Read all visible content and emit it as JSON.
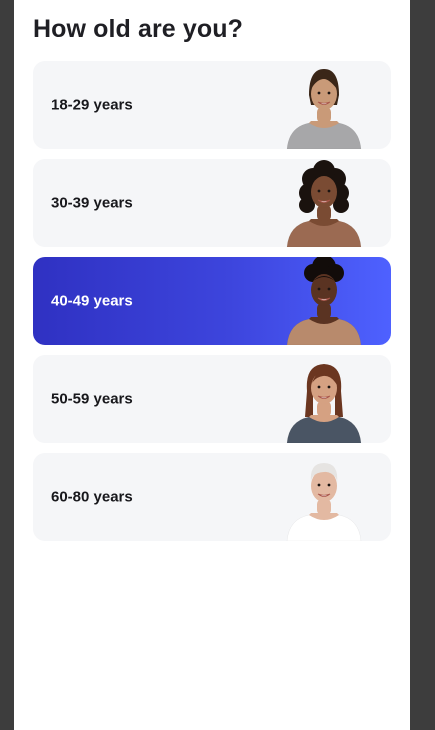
{
  "question": "How old are you?",
  "options": [
    {
      "label": "18-29 years",
      "selected": false,
      "skin": "#c99a78",
      "hair": "#3a2618",
      "top": "#a7a7a9",
      "hair_style": "bun"
    },
    {
      "label": "30-39 years",
      "selected": false,
      "skin": "#7a4b33",
      "hair": "#1a120e",
      "top": "#9b6a52",
      "hair_style": "curly"
    },
    {
      "label": "40-49 years",
      "selected": true,
      "skin": "#5a3322",
      "hair": "#120c0a",
      "top": "#b88a6c",
      "hair_style": "puff"
    },
    {
      "label": "50-59 years",
      "selected": false,
      "skin": "#d5a182",
      "hair": "#6b3620",
      "top": "#4a5564",
      "hair_style": "long"
    },
    {
      "label": "60-80 years",
      "selected": false,
      "skin": "#e3b9a2",
      "hair": "#e6e4e2",
      "top": "#ffffff",
      "hair_style": "short"
    }
  ],
  "colors": {
    "page_bg": "#3d3d3d",
    "card_bg": "#f5f6f8",
    "selected_gradient_start": "#2f31c2",
    "selected_gradient_end": "#4e61ff"
  }
}
